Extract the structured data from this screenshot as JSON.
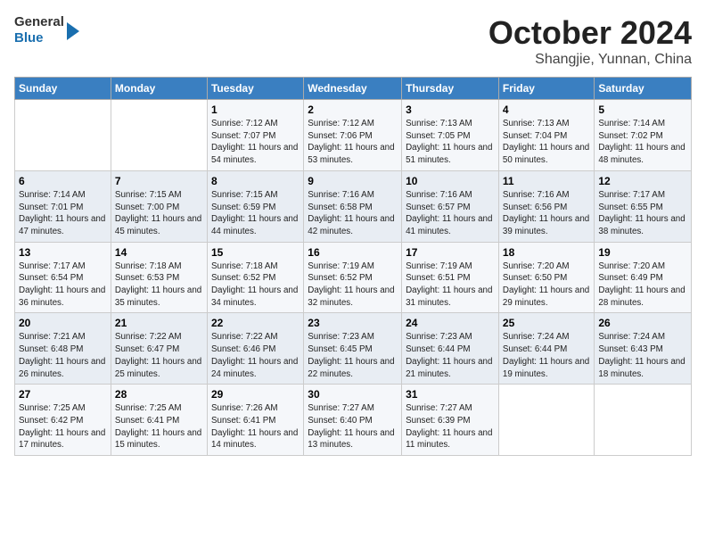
{
  "header": {
    "logo": {
      "general": "General",
      "blue": "Blue"
    },
    "title": "October 2024",
    "location": "Shangjie, Yunnan, China"
  },
  "days_of_week": [
    "Sunday",
    "Monday",
    "Tuesday",
    "Wednesday",
    "Thursday",
    "Friday",
    "Saturday"
  ],
  "weeks": [
    [
      {
        "day": "",
        "info": ""
      },
      {
        "day": "",
        "info": ""
      },
      {
        "day": "1",
        "info": "Sunrise: 7:12 AM\nSunset: 7:07 PM\nDaylight: 11 hours and 54 minutes."
      },
      {
        "day": "2",
        "info": "Sunrise: 7:12 AM\nSunset: 7:06 PM\nDaylight: 11 hours and 53 minutes."
      },
      {
        "day": "3",
        "info": "Sunrise: 7:13 AM\nSunset: 7:05 PM\nDaylight: 11 hours and 51 minutes."
      },
      {
        "day": "4",
        "info": "Sunrise: 7:13 AM\nSunset: 7:04 PM\nDaylight: 11 hours and 50 minutes."
      },
      {
        "day": "5",
        "info": "Sunrise: 7:14 AM\nSunset: 7:02 PM\nDaylight: 11 hours and 48 minutes."
      }
    ],
    [
      {
        "day": "6",
        "info": "Sunrise: 7:14 AM\nSunset: 7:01 PM\nDaylight: 11 hours and 47 minutes."
      },
      {
        "day": "7",
        "info": "Sunrise: 7:15 AM\nSunset: 7:00 PM\nDaylight: 11 hours and 45 minutes."
      },
      {
        "day": "8",
        "info": "Sunrise: 7:15 AM\nSunset: 6:59 PM\nDaylight: 11 hours and 44 minutes."
      },
      {
        "day": "9",
        "info": "Sunrise: 7:16 AM\nSunset: 6:58 PM\nDaylight: 11 hours and 42 minutes."
      },
      {
        "day": "10",
        "info": "Sunrise: 7:16 AM\nSunset: 6:57 PM\nDaylight: 11 hours and 41 minutes."
      },
      {
        "day": "11",
        "info": "Sunrise: 7:16 AM\nSunset: 6:56 PM\nDaylight: 11 hours and 39 minutes."
      },
      {
        "day": "12",
        "info": "Sunrise: 7:17 AM\nSunset: 6:55 PM\nDaylight: 11 hours and 38 minutes."
      }
    ],
    [
      {
        "day": "13",
        "info": "Sunrise: 7:17 AM\nSunset: 6:54 PM\nDaylight: 11 hours and 36 minutes."
      },
      {
        "day": "14",
        "info": "Sunrise: 7:18 AM\nSunset: 6:53 PM\nDaylight: 11 hours and 35 minutes."
      },
      {
        "day": "15",
        "info": "Sunrise: 7:18 AM\nSunset: 6:52 PM\nDaylight: 11 hours and 34 minutes."
      },
      {
        "day": "16",
        "info": "Sunrise: 7:19 AM\nSunset: 6:52 PM\nDaylight: 11 hours and 32 minutes."
      },
      {
        "day": "17",
        "info": "Sunrise: 7:19 AM\nSunset: 6:51 PM\nDaylight: 11 hours and 31 minutes."
      },
      {
        "day": "18",
        "info": "Sunrise: 7:20 AM\nSunset: 6:50 PM\nDaylight: 11 hours and 29 minutes."
      },
      {
        "day": "19",
        "info": "Sunrise: 7:20 AM\nSunset: 6:49 PM\nDaylight: 11 hours and 28 minutes."
      }
    ],
    [
      {
        "day": "20",
        "info": "Sunrise: 7:21 AM\nSunset: 6:48 PM\nDaylight: 11 hours and 26 minutes."
      },
      {
        "day": "21",
        "info": "Sunrise: 7:22 AM\nSunset: 6:47 PM\nDaylight: 11 hours and 25 minutes."
      },
      {
        "day": "22",
        "info": "Sunrise: 7:22 AM\nSunset: 6:46 PM\nDaylight: 11 hours and 24 minutes."
      },
      {
        "day": "23",
        "info": "Sunrise: 7:23 AM\nSunset: 6:45 PM\nDaylight: 11 hours and 22 minutes."
      },
      {
        "day": "24",
        "info": "Sunrise: 7:23 AM\nSunset: 6:44 PM\nDaylight: 11 hours and 21 minutes."
      },
      {
        "day": "25",
        "info": "Sunrise: 7:24 AM\nSunset: 6:44 PM\nDaylight: 11 hours and 19 minutes."
      },
      {
        "day": "26",
        "info": "Sunrise: 7:24 AM\nSunset: 6:43 PM\nDaylight: 11 hours and 18 minutes."
      }
    ],
    [
      {
        "day": "27",
        "info": "Sunrise: 7:25 AM\nSunset: 6:42 PM\nDaylight: 11 hours and 17 minutes."
      },
      {
        "day": "28",
        "info": "Sunrise: 7:25 AM\nSunset: 6:41 PM\nDaylight: 11 hours and 15 minutes."
      },
      {
        "day": "29",
        "info": "Sunrise: 7:26 AM\nSunset: 6:41 PM\nDaylight: 11 hours and 14 minutes."
      },
      {
        "day": "30",
        "info": "Sunrise: 7:27 AM\nSunset: 6:40 PM\nDaylight: 11 hours and 13 minutes."
      },
      {
        "day": "31",
        "info": "Sunrise: 7:27 AM\nSunset: 6:39 PM\nDaylight: 11 hours and 11 minutes."
      },
      {
        "day": "",
        "info": ""
      },
      {
        "day": "",
        "info": ""
      }
    ]
  ]
}
